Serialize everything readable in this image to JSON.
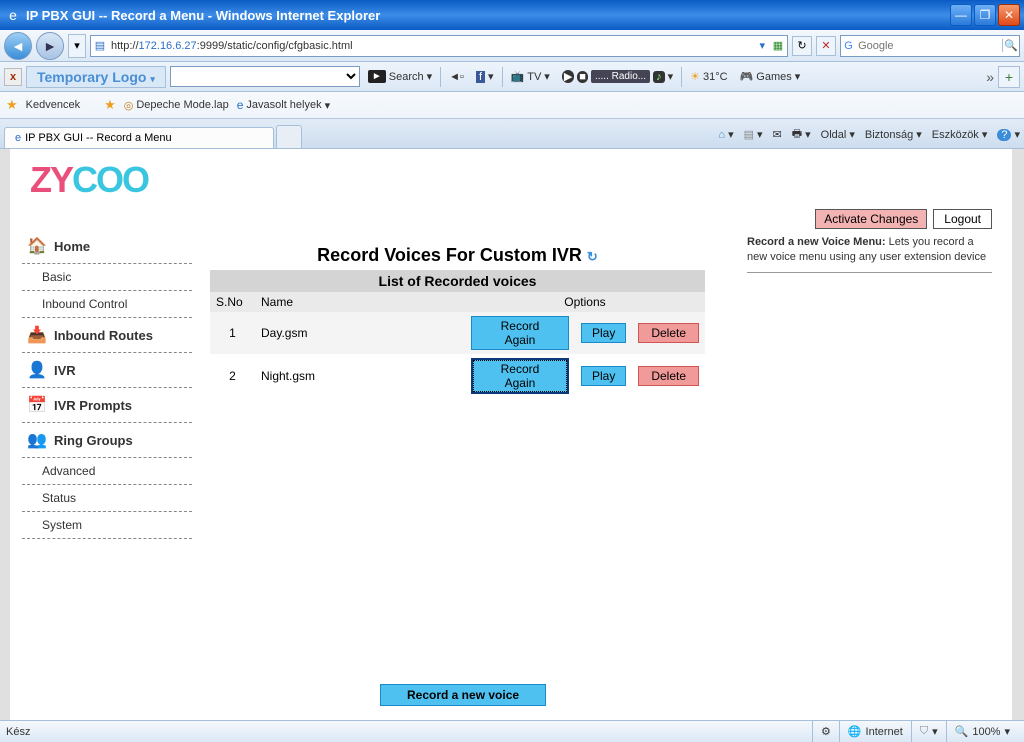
{
  "window": {
    "title": "IP PBX GUI -- Record a Menu - Windows Internet Explorer"
  },
  "address": {
    "url_prefix": "http://",
    "url_host": "172.16.6.27",
    "url_rest": ":9999/static/config/cfgbasic.html",
    "search_placeholder": "Google"
  },
  "toolbar2": {
    "temp_logo": "Temporary Logo",
    "search": "Search",
    "tv": "TV",
    "radio": "Radio...",
    "temp": "31°C",
    "games": "Games"
  },
  "favorites": {
    "label": "Kedvencek",
    "dm": "Depeche Mode.lap",
    "suggested": "Javasolt helyek"
  },
  "tab": {
    "title": "IP PBX GUI -- Record a Menu"
  },
  "tabmenu": {
    "page": "Oldal",
    "security": "Biztonság",
    "tools": "Eszközök"
  },
  "sidebar": {
    "home": "Home",
    "basic": "Basic",
    "inbound_control": "Inbound Control",
    "inbound_routes": "Inbound Routes",
    "ivr": "IVR",
    "ivr_prompts": "IVR Prompts",
    "ring_groups": "Ring Groups",
    "advanced": "Advanced",
    "status": "Status",
    "system": "System"
  },
  "page": {
    "title": "Record Voices For Custom IVR",
    "subhead": "List of Recorded voices",
    "col_sno": "S.No",
    "col_name": "Name",
    "col_options": "Options",
    "record_again": "Record Again",
    "play": "Play",
    "delete": "Delete",
    "record_new": "Record a new voice"
  },
  "rows": [
    {
      "sno": "1",
      "name": "Day.gsm"
    },
    {
      "sno": "2",
      "name": "Night.gsm"
    }
  ],
  "right": {
    "activate": "Activate Changes",
    "logout": "Logout",
    "help_bold": "Record a new Voice Menu:",
    "help_text": " Lets you record a new voice menu using any user extension device"
  },
  "status": {
    "ready": "Kész",
    "internet": "Internet",
    "zoom": "100%"
  }
}
